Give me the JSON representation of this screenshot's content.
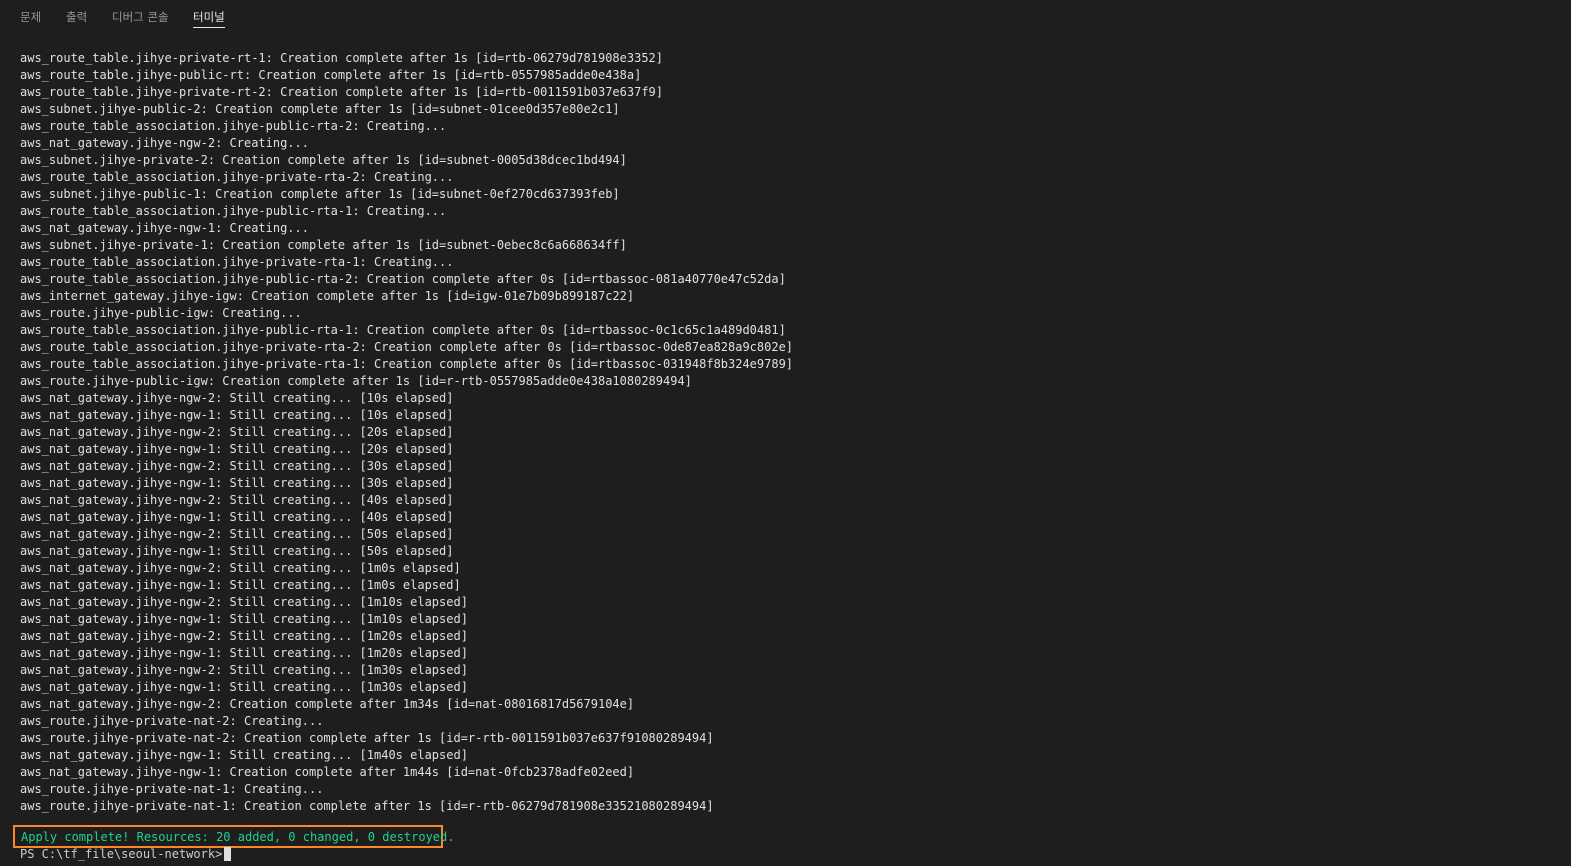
{
  "tabs": [
    {
      "label": "문제",
      "active": false
    },
    {
      "label": "출력",
      "active": false
    },
    {
      "label": "디버그 콘솔",
      "active": false
    },
    {
      "label": "터미널",
      "active": true
    }
  ],
  "terminal": {
    "lines": [
      "aws_route_table.jihye-private-rt-1: Creation complete after 1s [id=rtb-06279d781908e3352]",
      "aws_route_table.jihye-public-rt: Creation complete after 1s [id=rtb-0557985adde0e438a]",
      "aws_route_table.jihye-private-rt-2: Creation complete after 1s [id=rtb-0011591b037e637f9]",
      "aws_subnet.jihye-public-2: Creation complete after 1s [id=subnet-01cee0d357e80e2c1]",
      "aws_route_table_association.jihye-public-rta-2: Creating...",
      "aws_nat_gateway.jihye-ngw-2: Creating...",
      "aws_subnet.jihye-private-2: Creation complete after 1s [id=subnet-0005d38dcec1bd494]",
      "aws_route_table_association.jihye-private-rta-2: Creating...",
      "aws_subnet.jihye-public-1: Creation complete after 1s [id=subnet-0ef270cd637393feb]",
      "aws_route_table_association.jihye-public-rta-1: Creating...",
      "aws_nat_gateway.jihye-ngw-1: Creating...",
      "aws_subnet.jihye-private-1: Creation complete after 1s [id=subnet-0ebec8c6a668634ff]",
      "aws_route_table_association.jihye-private-rta-1: Creating...",
      "aws_route_table_association.jihye-public-rta-2: Creation complete after 0s [id=rtbassoc-081a40770e47c52da]",
      "aws_internet_gateway.jihye-igw: Creation complete after 1s [id=igw-01e7b09b899187c22]",
      "aws_route.jihye-public-igw: Creating...",
      "aws_route_table_association.jihye-public-rta-1: Creation complete after 0s [id=rtbassoc-0c1c65c1a489d0481]",
      "aws_route_table_association.jihye-private-rta-2: Creation complete after 0s [id=rtbassoc-0de87ea828a9c802e]",
      "aws_route_table_association.jihye-private-rta-1: Creation complete after 0s [id=rtbassoc-031948f8b324e9789]",
      "aws_route.jihye-public-igw: Creation complete after 1s [id=r-rtb-0557985adde0e438a1080289494]",
      "aws_nat_gateway.jihye-ngw-2: Still creating... [10s elapsed]",
      "aws_nat_gateway.jihye-ngw-1: Still creating... [10s elapsed]",
      "aws_nat_gateway.jihye-ngw-2: Still creating... [20s elapsed]",
      "aws_nat_gateway.jihye-ngw-1: Still creating... [20s elapsed]",
      "aws_nat_gateway.jihye-ngw-2: Still creating... [30s elapsed]",
      "aws_nat_gateway.jihye-ngw-1: Still creating... [30s elapsed]",
      "aws_nat_gateway.jihye-ngw-2: Still creating... [40s elapsed]",
      "aws_nat_gateway.jihye-ngw-1: Still creating... [40s elapsed]",
      "aws_nat_gateway.jihye-ngw-2: Still creating... [50s elapsed]",
      "aws_nat_gateway.jihye-ngw-1: Still creating... [50s elapsed]",
      "aws_nat_gateway.jihye-ngw-2: Still creating... [1m0s elapsed]",
      "aws_nat_gateway.jihye-ngw-1: Still creating... [1m0s elapsed]",
      "aws_nat_gateway.jihye-ngw-2: Still creating... [1m10s elapsed]",
      "aws_nat_gateway.jihye-ngw-1: Still creating... [1m10s elapsed]",
      "aws_nat_gateway.jihye-ngw-2: Still creating... [1m20s elapsed]",
      "aws_nat_gateway.jihye-ngw-1: Still creating... [1m20s elapsed]",
      "aws_nat_gateway.jihye-ngw-2: Still creating... [1m30s elapsed]",
      "aws_nat_gateway.jihye-ngw-1: Still creating... [1m30s elapsed]",
      "aws_nat_gateway.jihye-ngw-2: Creation complete after 1m34s [id=nat-08016817d5679104e]",
      "aws_route.jihye-private-nat-2: Creating...",
      "aws_route.jihye-private-nat-2: Creation complete after 1s [id=r-rtb-0011591b037e637f91080289494]",
      "aws_nat_gateway.jihye-ngw-1: Still creating... [1m40s elapsed]",
      "aws_nat_gateway.jihye-ngw-1: Creation complete after 1m44s [id=nat-0fcb2378adfe02eed]",
      "aws_route.jihye-private-nat-1: Creating...",
      "aws_route.jihye-private-nat-1: Creation complete after 1s [id=r-rtb-06279d781908e33521080289494]"
    ],
    "summary": "Apply complete! Resources: 20 added, 0 changed, 0 destroyed.",
    "prompt": "PS C:\\tf_file\\seoul-network>"
  },
  "colors": {
    "background": "#1e1e1e",
    "summary_text": "#23d18b",
    "highlight_box": "#f7882f"
  }
}
